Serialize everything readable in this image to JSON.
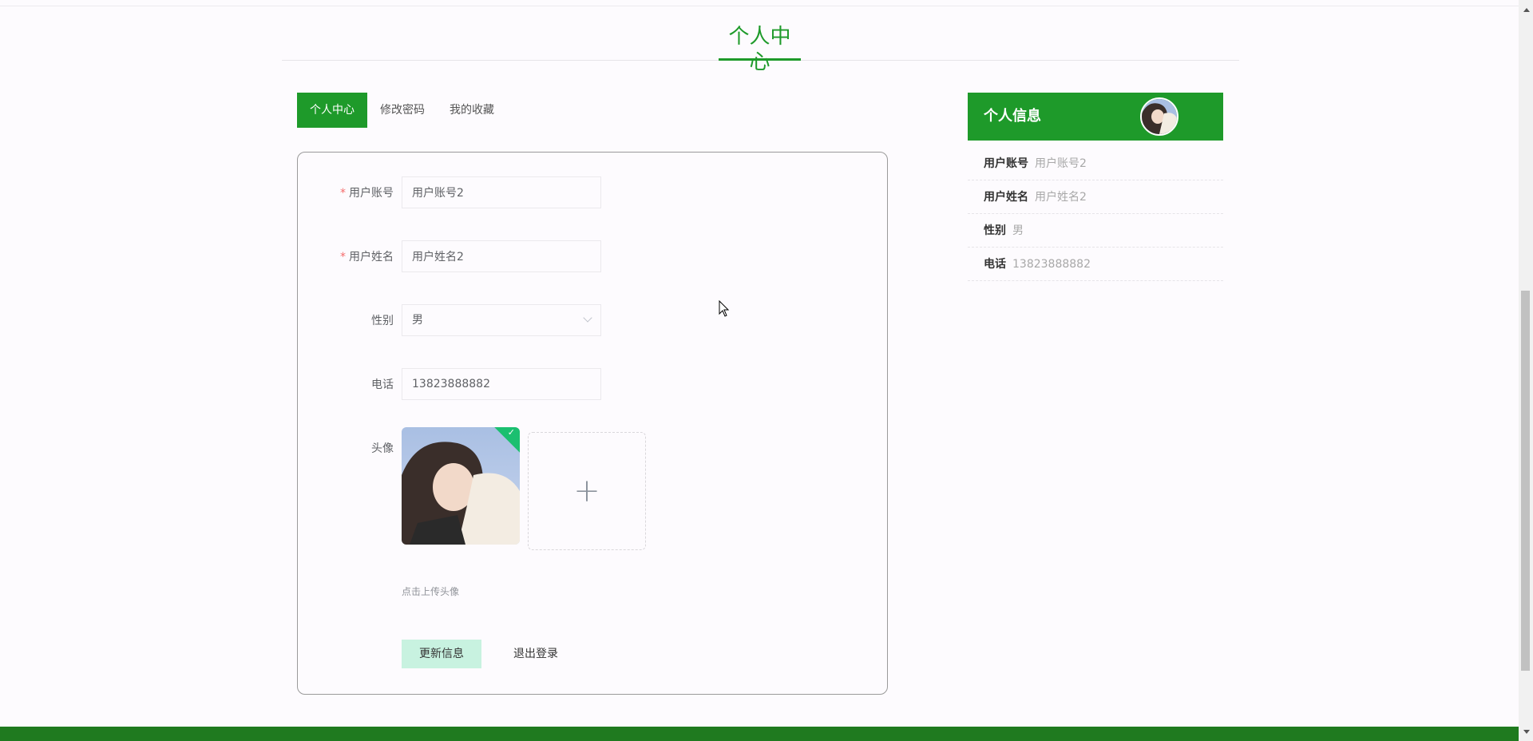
{
  "page": {
    "title": "个人中心"
  },
  "tabs": [
    {
      "label": "个人中心",
      "active": true
    },
    {
      "label": "修改密码",
      "active": false
    },
    {
      "label": "我的收藏",
      "active": false
    }
  ],
  "form": {
    "account": {
      "label": "用户账号",
      "value": "用户账号2"
    },
    "name": {
      "label": "用户姓名",
      "value": "用户姓名2"
    },
    "gender": {
      "label": "性别",
      "value": "男"
    },
    "phone": {
      "label": "电话",
      "value": "13823888882"
    },
    "avatar": {
      "label": "头像",
      "tip": "点击上传头像"
    },
    "update_label": "更新信息",
    "logout_label": "退出登录"
  },
  "info": {
    "title": "个人信息",
    "rows": [
      {
        "key": "用户账号",
        "value": "用户账号2"
      },
      {
        "key": "用户姓名",
        "value": "用户姓名2"
      },
      {
        "key": "性别",
        "value": "男"
      },
      {
        "key": "电话",
        "value": "13823888882"
      }
    ]
  },
  "colors": {
    "primary": "#1e9a2a",
    "footer": "#1f7a1f",
    "update_button": "#c8f2e0",
    "success": "#1bbf70"
  },
  "icons": {
    "upload": "plus-icon",
    "success": "check-icon",
    "select": "chevron-down-icon"
  }
}
